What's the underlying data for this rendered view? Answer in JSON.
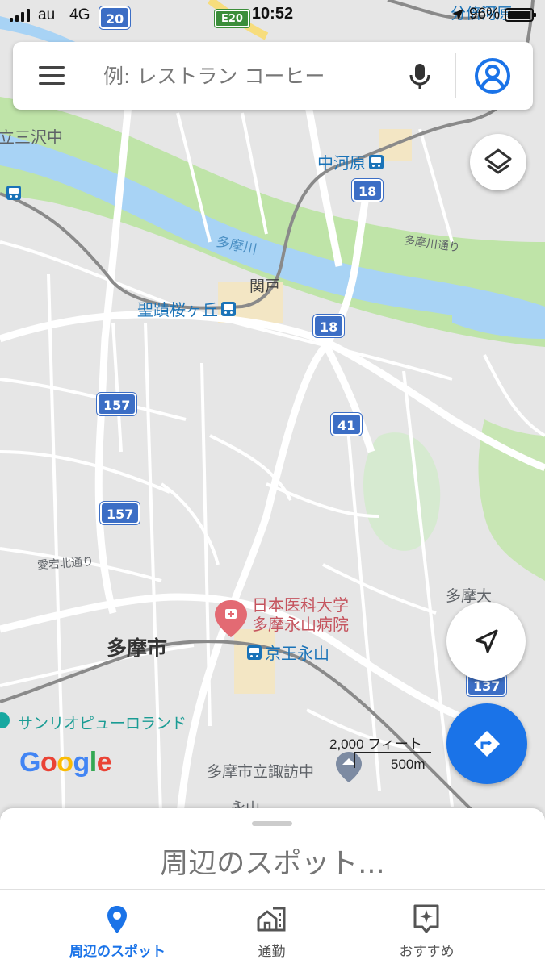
{
  "status_bar": {
    "carrier": "au",
    "network": "4G",
    "time": "10:52",
    "battery_percent": "96%"
  },
  "search": {
    "placeholder": "例: レストラン コーヒー",
    "value": ""
  },
  "map": {
    "route_shields": [
      {
        "label": "20",
        "color": "#3c6ec5"
      },
      {
        "label": "E20",
        "color": "#3b8e3a"
      },
      {
        "label": "18",
        "color": "#3c6ec5"
      },
      {
        "label": "18",
        "color": "#3c6ec5"
      },
      {
        "label": "157",
        "color": "#3c6ec5"
      },
      {
        "label": "41",
        "color": "#3c6ec5"
      },
      {
        "label": "157",
        "color": "#3c6ec5"
      },
      {
        "label": "137",
        "color": "#3c6ec5"
      }
    ],
    "stations": {
      "nakagawara": "中河原",
      "seiseki": "聖蹟桜ヶ丘",
      "keio_nagayama": "京王永山",
      "top_left_partial": "",
      "top_right_partial": "分倍河原"
    },
    "places": {
      "school_sanzawa": "立三沢中",
      "tama_river": "多摩川",
      "tama_river_road": "多摩川通り",
      "sekido": "関戸",
      "atago_road": "愛宕北通り",
      "tama_city": "多摩市",
      "tama_univ": "多摩大",
      "hospital": "日本医科大学\n多摩永山病院",
      "sanrio": "サンリオピューロランド",
      "suwa_school": "多摩市立諏訪中",
      "nagayama_partial": "永山"
    },
    "scale": {
      "imperial": "2,000 フィート",
      "metric": "500m"
    },
    "attribution": "Google",
    "colors": {
      "water": "#a8d3f5",
      "park": "#bfe4a8",
      "road": "#ffffff",
      "highway": "#f7dd7d",
      "accent": "#1a73e8"
    }
  },
  "bottom_sheet": {
    "title": "周辺のスポット..."
  },
  "bottom_nav": {
    "tabs": [
      {
        "label": "周辺のスポット",
        "icon": "place-pin-icon",
        "active": true
      },
      {
        "label": "通勤",
        "icon": "commute-icon",
        "active": false
      },
      {
        "label": "おすすめ",
        "icon": "for-you-icon",
        "active": false
      }
    ]
  }
}
